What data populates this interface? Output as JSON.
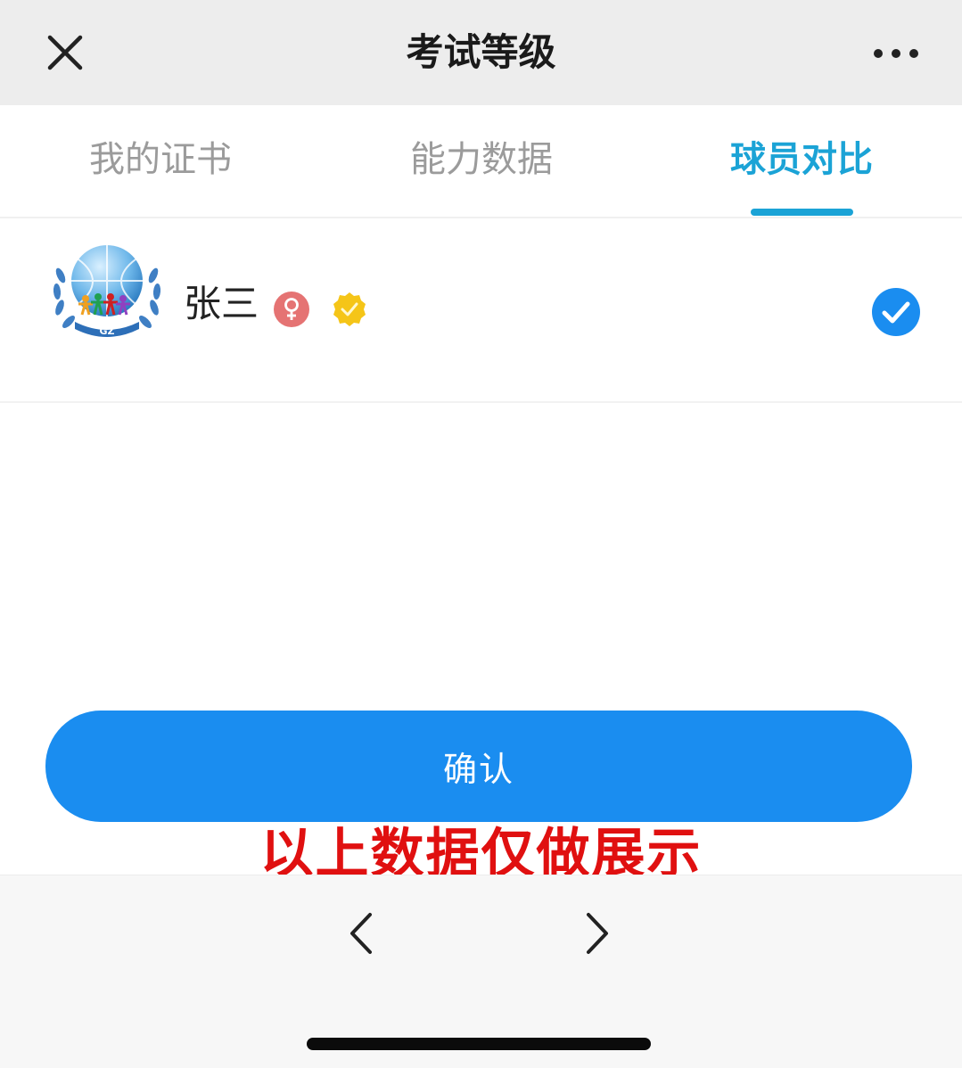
{
  "header": {
    "title": "考试等级",
    "close_icon": "close-icon",
    "more_icon": "more-horizontal-icon"
  },
  "tabs": [
    {
      "label": "我的证书",
      "active": false
    },
    {
      "label": "能力数据",
      "active": false
    },
    {
      "label": "球员对比",
      "active": true
    }
  ],
  "player": {
    "name": "张三",
    "avatar_text": "GZ",
    "gender_icon": "female-icon",
    "badge_icon": "verified-badge-icon",
    "selected": true
  },
  "actions": {
    "confirm_label": "确认"
  },
  "watermark": "以上数据仅做展示",
  "navigation": {
    "back_icon": "chevron-left-icon",
    "forward_icon": "chevron-right-icon"
  },
  "colors": {
    "accent": "#1ba3d6",
    "button": "#1a8df0",
    "watermark": "#e01010",
    "gender": "#e57373",
    "badge": "#f5c518",
    "check": "#1a8df0"
  }
}
